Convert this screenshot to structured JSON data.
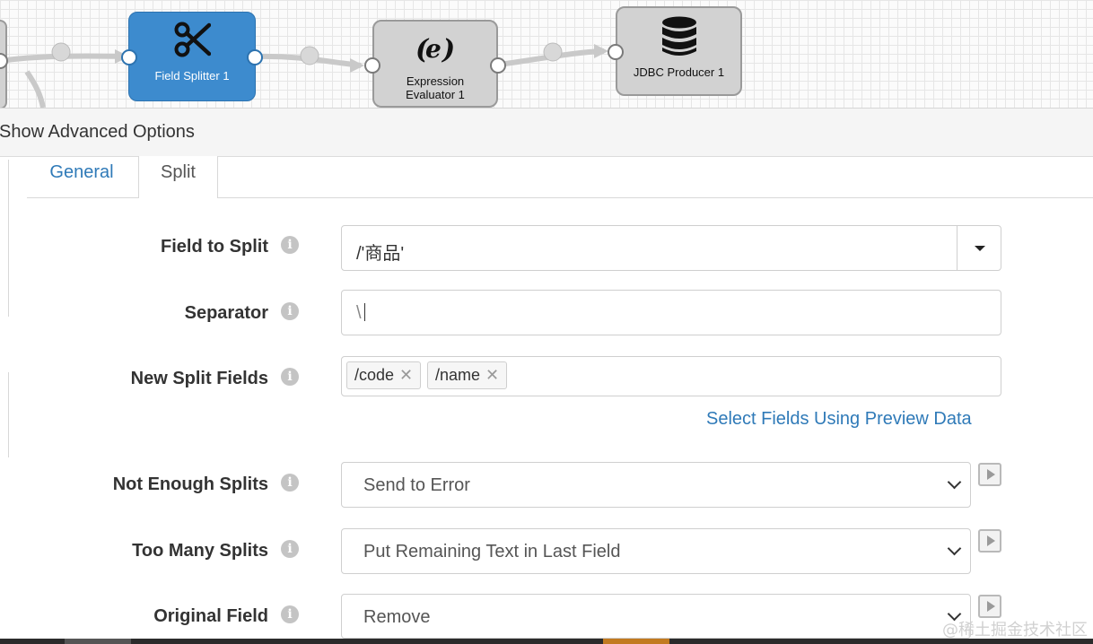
{
  "pipeline": {
    "nodes": [
      {
        "label": "Field Splitter 1",
        "icon": "scissors-icon",
        "selected": true
      },
      {
        "label_line1": "Expression",
        "label_line2": "Evaluator 1",
        "icon": "expression-e-icon",
        "selected": false
      },
      {
        "label": "JDBC Producer 1",
        "icon": "database-icon",
        "selected": false
      }
    ]
  },
  "advanced_options": {
    "label": "Show Advanced Options"
  },
  "tabs": [
    {
      "label": "General",
      "active": false
    },
    {
      "label": "Split",
      "active": true
    }
  ],
  "form": {
    "field_to_split": {
      "label": "Field to Split",
      "value": "/'商品'"
    },
    "separator": {
      "label": "Separator",
      "value": "\\"
    },
    "new_split_fields": {
      "label": "New Split Fields",
      "chips": [
        "/code",
        "/name"
      ]
    },
    "select_fields_link": "Select Fields Using Preview Data",
    "not_enough_splits": {
      "label": "Not Enough Splits",
      "value": "Send to Error"
    },
    "too_many_splits": {
      "label": "Too Many Splits",
      "value": "Put Remaining Text in Last Field"
    },
    "original_field": {
      "label": "Original Field",
      "value": "Remove"
    }
  },
  "watermark": "@稀土掘金技术社区",
  "colors": {
    "accent": "#3d8bce",
    "link": "#2f7ab8",
    "node_gray": "#d2d2d2"
  }
}
